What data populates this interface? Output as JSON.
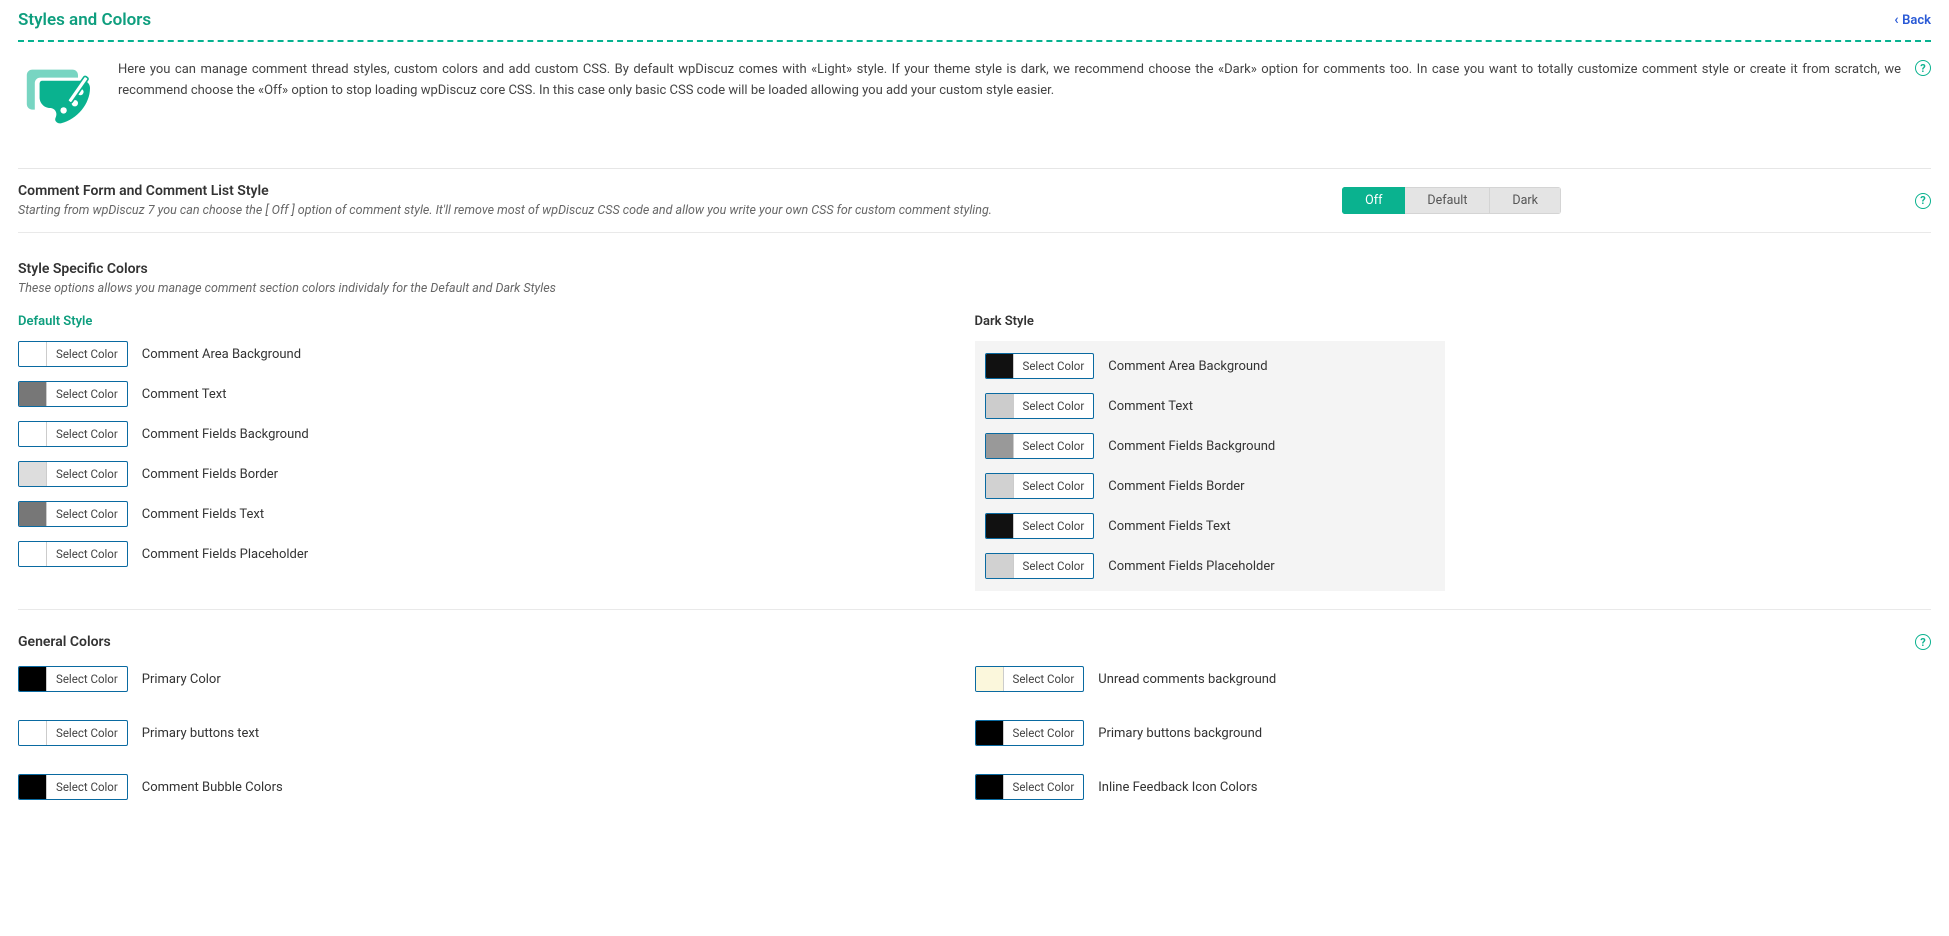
{
  "header": {
    "title": "Styles and Colors",
    "back_label": "Back"
  },
  "intro": {
    "text": "Here you can manage comment thread styles, custom colors and add custom CSS. By default wpDiscuz comes with «Light» style. If your theme style is dark, we recommend choose the «Dark» option for comments too. In case you want to totally customize comment style or create it from scratch, we recommend choose the «Off» option to stop loading wpDiscuz core CSS. In this case only basic CSS code will be loaded allowing you add your custom style easier."
  },
  "style_setting": {
    "title": "Comment Form and Comment List Style",
    "desc": "Starting from wpDiscuz 7 you can choose the [ Off ] option of comment style. It'll remove most of wpDiscuz CSS code and allow you write your own CSS for custom comment styling.",
    "options": {
      "off": "Off",
      "default": "Default",
      "dark": "Dark"
    }
  },
  "specific": {
    "title": "Style Specific Colors",
    "desc": "These options allows you manage comment section colors individaly for the Default and Dark Styles",
    "default_title": "Default Style",
    "dark_title": "Dark Style",
    "select_label": "Select Color",
    "rows": {
      "area_bg": "Comment Area Background",
      "text": "Comment Text",
      "fields_bg": "Comment Fields Background",
      "fields_border": "Comment Fields Border",
      "fields_text": "Comment Fields Text",
      "fields_placeholder": "Comment Fields Placeholder"
    },
    "default_colors": {
      "area_bg": "#ffffff",
      "text": "#777777",
      "fields_bg": "#ffffff",
      "fields_border": "#dddddd",
      "fields_text": "#777777",
      "fields_placeholder": "#ffffff"
    },
    "dark_colors": {
      "area_bg": "#111111",
      "text": "#cccccc",
      "fields_bg": "#999999",
      "fields_border": "#d1d1d1",
      "fields_text": "#111111",
      "fields_placeholder": "#d1d1d1"
    }
  },
  "general": {
    "title": "General Colors",
    "select_label": "Select Color",
    "left": {
      "primary_color": {
        "label": "Primary Color",
        "color": "#000000"
      },
      "primary_btn_text": {
        "label": "Primary buttons text",
        "color": "#ffffff"
      },
      "bubble": {
        "label": "Comment Bubble Colors",
        "color": "#000000"
      }
    },
    "right": {
      "unread_bg": {
        "label": "Unread comments background",
        "color": "#fbf7dc"
      },
      "primary_btn_bg": {
        "label": "Primary buttons background",
        "color": "#000000"
      },
      "feedback_icon": {
        "label": "Inline Feedback Icon Colors",
        "color": "#000000"
      }
    }
  }
}
